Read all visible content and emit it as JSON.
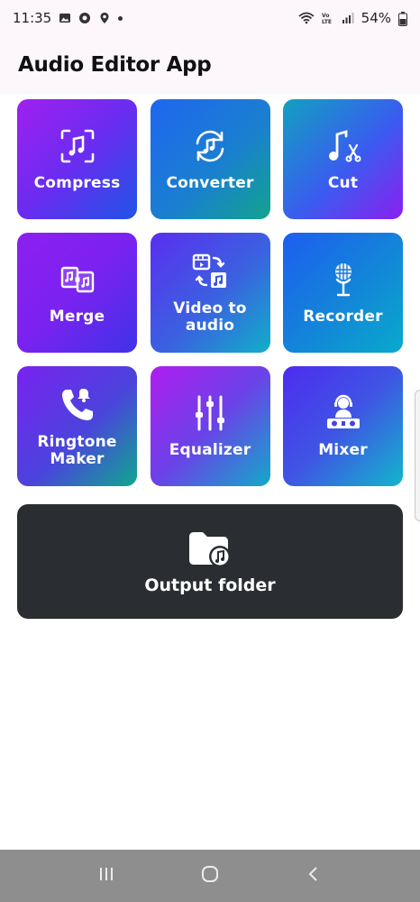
{
  "status_bar": {
    "time": "11:35",
    "battery": "54%",
    "icons": [
      "gallery-icon",
      "settings-icon",
      "location-icon",
      "dot-icon",
      "wifi-icon",
      "volte-icon",
      "signal-icon",
      "battery-icon"
    ]
  },
  "app_bar": {
    "title": "Audio Editor App"
  },
  "tiles": [
    {
      "label": "Compress",
      "icon": "compress-music-icon"
    },
    {
      "label": "Converter",
      "icon": "convert-music-icon"
    },
    {
      "label": "Cut",
      "icon": "music-cut-icon"
    },
    {
      "label": "Merge",
      "icon": "merge-music-icon"
    },
    {
      "label": "Video to audio",
      "icon": "video-to-audio-icon"
    },
    {
      "label": "Recorder",
      "icon": "microphone-icon"
    },
    {
      "label": "Ringtone Maker",
      "icon": "phone-bell-icon"
    },
    {
      "label": "Equalizer",
      "icon": "equalizer-icon"
    },
    {
      "label": "Mixer",
      "icon": "dj-mixer-icon"
    }
  ],
  "output": {
    "label": "Output folder",
    "icon": "music-folder-icon"
  },
  "nav_bar": {
    "buttons": [
      "recent-apps-icon",
      "home-icon",
      "back-icon"
    ]
  }
}
